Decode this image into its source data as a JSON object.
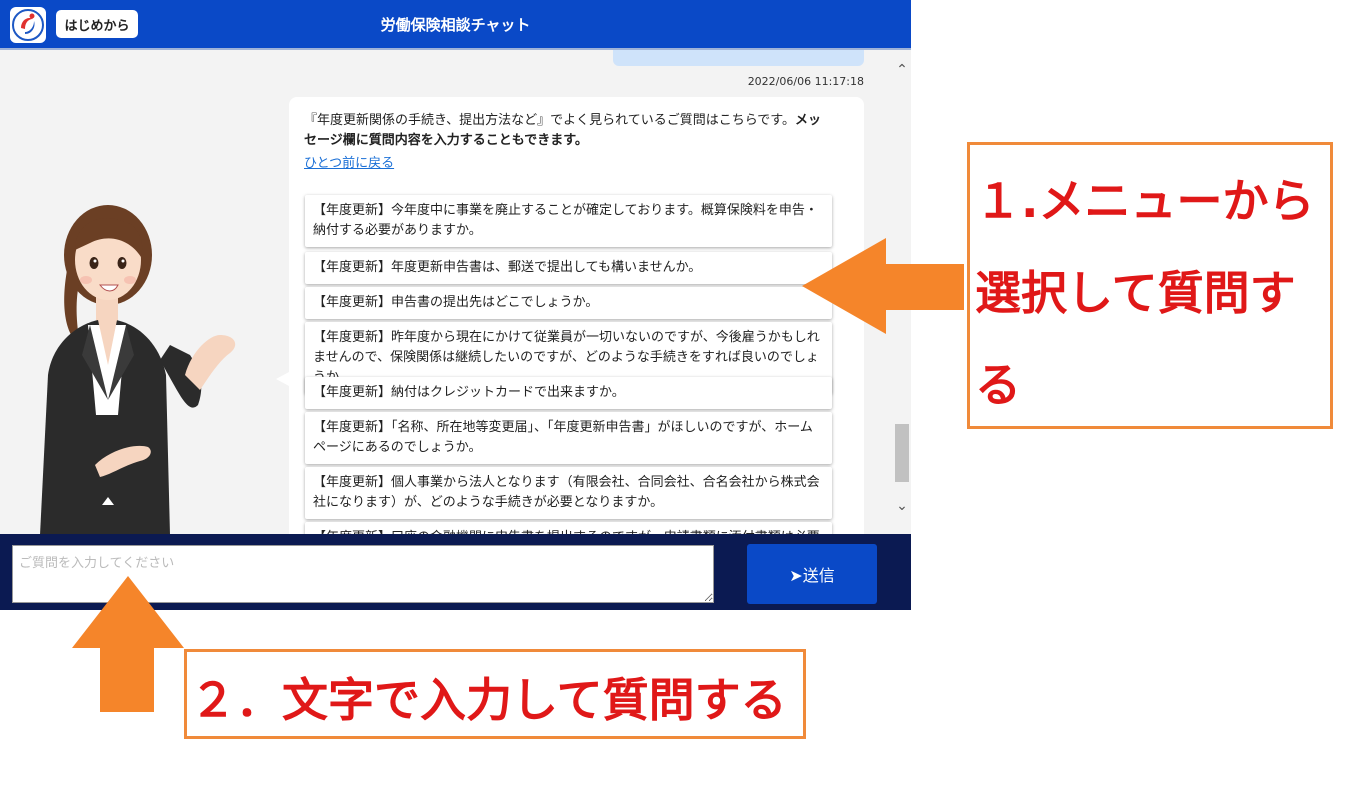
{
  "header": {
    "restart_label": "はじめから",
    "title": "労働保険相談チャット"
  },
  "chat": {
    "timestamp": "2022/06/06 11:17:18",
    "bot_message_normal": "『年度更新関係の手続き、提出方法など』でよく見られているご質問はこちらです。",
    "bot_message_bold": "メッセージ欄に質問内容を入力することもできます。",
    "back_link": "ひとつ前に戻る",
    "questions": [
      "【年度更新】今年度中に事業を廃止することが確定しております。概算保険料を申告・納付する必要がありますか。",
      "【年度更新】年度更新申告書は、郵送で提出しても構いませんか。",
      "【年度更新】申告書の提出先はどこでしょうか。",
      "【年度更新】昨年度から現在にかけて従業員が一切いないのですが、今後雇うかもしれませんので、保険関係は継続したいのですが、どのような手続きをすれば良いのでしょうか。",
      "【年度更新】納付はクレジットカードで出来ますか。",
      "【年度更新】「名称、所在地等変更届」、「年度更新申告書」がほしいのですが、ホームページにあるのでしょうか。",
      "【年度更新】個人事業から法人となります（有限会社、合同会社、合名会社から株式会社になります）が、どのような手続きが必要となりますか。",
      "【年度更新】口座の金融機関に申告書を提出するのですが、申請書類に添付書類は必要ですか。"
    ]
  },
  "input": {
    "placeholder": "ご質問を入力してください",
    "send_label": "送信"
  },
  "annotations": {
    "menu_note": "１.メニューから選択して質問する",
    "text_note": "２．文字で入力して質問する"
  },
  "colors": {
    "header_blue": "#0a49c7",
    "input_bar_navy": "#0b1a52",
    "annotation_red": "#e01818",
    "annotation_orange": "#f08a3a"
  }
}
